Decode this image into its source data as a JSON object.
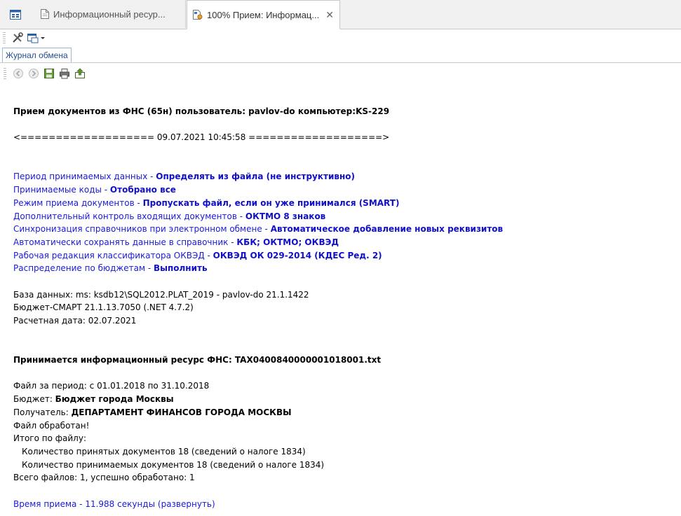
{
  "tabs": [
    {
      "label": "Информационный ресур..."
    },
    {
      "label": "100% Прием: Информац..."
    }
  ],
  "subtab": {
    "label": "Журнал обмена"
  },
  "icons": {
    "home": "window-icon",
    "tab1": "document-icon",
    "tab2": "document-settings-icon",
    "close": "close-icon",
    "tools": "tools-icon",
    "view": "view-dropdown-icon",
    "back": "back-arrow-icon",
    "forward": "forward-arrow-icon",
    "save": "save-icon",
    "print": "print-icon",
    "export": "export-icon"
  },
  "log": {
    "header": "Прием документов из ФНС (65н) пользователь: pavlov-do компьютер:KS-229",
    "separator": "<=================== 09.07.2021 10:45:58 ===================>",
    "settings": [
      {
        "label": "Период принимаемых данных - ",
        "value": "Определять из файла (не инструктивно)"
      },
      {
        "label": "Принимаемые коды - ",
        "value": "Отобрано все"
      },
      {
        "label": "Режим приема документов - ",
        "value": "Пропускать файл, если он уже принимался (SMART)"
      },
      {
        "label": "Дополнительный контроль входящих документов - ",
        "value": "ОКТМО 8 знаков"
      },
      {
        "label": "Синхронизация справочников при электронном обмене - ",
        "value": "Автоматическое добавление новых реквизитов"
      },
      {
        "label": "Автоматически сохранять данные в справочник - ",
        "value": "КБК; ОКТМО; ОКВЭД"
      },
      {
        "label": "Рабочая редакция классификатора ОКВЭД - ",
        "value": "ОКВЭД ОК 029-2014 (КДЕС Ред. 2)"
      },
      {
        "label": "Распределение по бюджетам - ",
        "value": "Выполнить"
      }
    ],
    "database": "База данных: ms: ksdb12\\SQL2012.PLAT_2019 - pavlov-do 21.1.1422",
    "version": "Бюджет-СМАРТ 21.1.13.7050 (.NET 4.7.2)",
    "calc_date": "Расчетная дата: 02.07.2021",
    "resource_header": "Принимается информационный ресурс ФНС: TAX0400840000001018001.txt",
    "period": "Файл за период: с 01.01.2018 по 31.10.2018",
    "budget_label": "Бюджет: ",
    "budget_value": "Бюджет города Москвы",
    "recipient_label": "Получатель: ",
    "recipient_value": "ДЕПАРТАМЕНТ ФИНАНСОВ ГОРОДА МОСКВЫ",
    "processed": "Файл обработан!",
    "total_file": "Итого по файлу:",
    "accepted": "Количество принятых документов 18 (сведений о налоге 1834)",
    "receiving": "Количество принимаемых документов 18 (сведений о налоге 1834)",
    "total_files": "Всего файлов: 1, успешно обработано: 1",
    "time": "Время приема - 11.988 секунды (развернуть)"
  }
}
